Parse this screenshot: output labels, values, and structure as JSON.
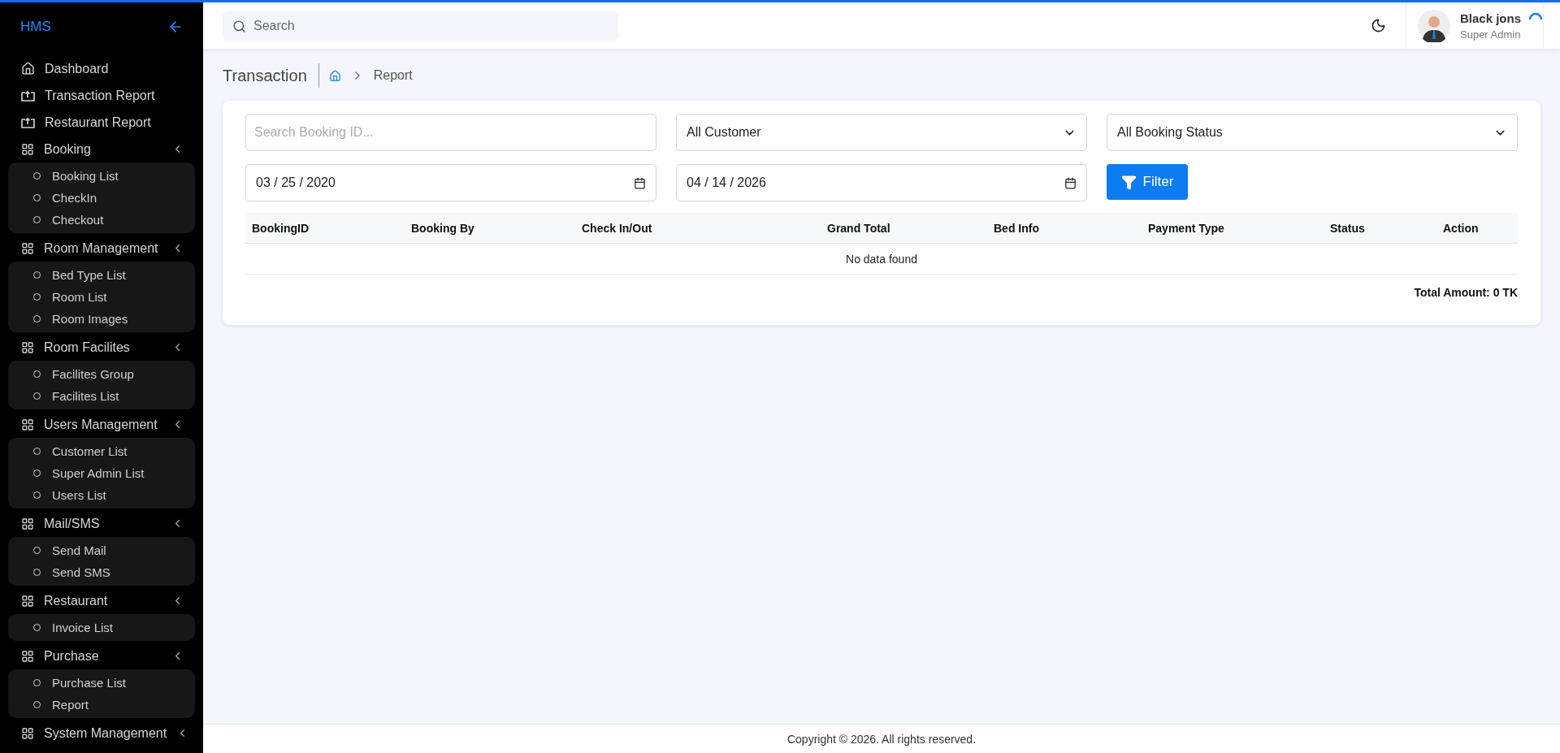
{
  "sidebar": {
    "brand": "HMS",
    "items": [
      {
        "kind": "home",
        "label": "Dashboard"
      },
      {
        "kind": "report",
        "label": "Transaction Report"
      },
      {
        "kind": "report",
        "label": "Restaurant Report"
      },
      {
        "kind": "group",
        "label": "Booking",
        "children": [
          {
            "label": "Booking List"
          },
          {
            "label": "CheckIn"
          },
          {
            "label": "Checkout"
          }
        ]
      },
      {
        "kind": "group",
        "label": "Room Management",
        "children": [
          {
            "label": "Bed Type List"
          },
          {
            "label": "Room List"
          },
          {
            "label": "Room Images"
          }
        ]
      },
      {
        "kind": "group",
        "label": "Room Facilites",
        "children": [
          {
            "label": "Facilites Group"
          },
          {
            "label": "Facilites List"
          }
        ]
      },
      {
        "kind": "group",
        "label": "Users Management",
        "children": [
          {
            "label": "Customer List"
          },
          {
            "label": "Super Admin List"
          },
          {
            "label": "Users List"
          }
        ]
      },
      {
        "kind": "group",
        "label": "Mail/SMS",
        "children": [
          {
            "label": "Send Mail"
          },
          {
            "label": "Send SMS"
          }
        ]
      },
      {
        "kind": "group",
        "label": "Restaurant",
        "children": [
          {
            "label": "Invoice List"
          }
        ]
      },
      {
        "kind": "group",
        "label": "Purchase",
        "children": [
          {
            "label": "Purchase List"
          },
          {
            "label": "Report"
          }
        ]
      },
      {
        "kind": "group",
        "label": "System Management"
      }
    ]
  },
  "topbar": {
    "search": {
      "placeholder": "Search"
    },
    "user": {
      "name": "Black jons",
      "role": "Super Admin"
    }
  },
  "page": {
    "title": "Transaction",
    "breadcrumb": [
      "Report"
    ]
  },
  "filters": {
    "search": {
      "placeholder": "Search Booking ID..."
    },
    "customer": {
      "value": "All Customer"
    },
    "status": {
      "value": "All Booking Status"
    },
    "date_from": {
      "value": "03 / 25 / 2020"
    },
    "date_to": {
      "value": "04 / 14 / 2026"
    },
    "button": "Filter"
  },
  "table": {
    "columns": [
      "BookingID",
      "Booking By",
      "Check In/Out",
      "Grand Total",
      "Bed Info",
      "Payment Type",
      "Status",
      "Action"
    ],
    "empty": "No data found",
    "total": "Total Amount: 0 TK"
  },
  "footer": "Copyright © 2026. All rights reserved."
}
